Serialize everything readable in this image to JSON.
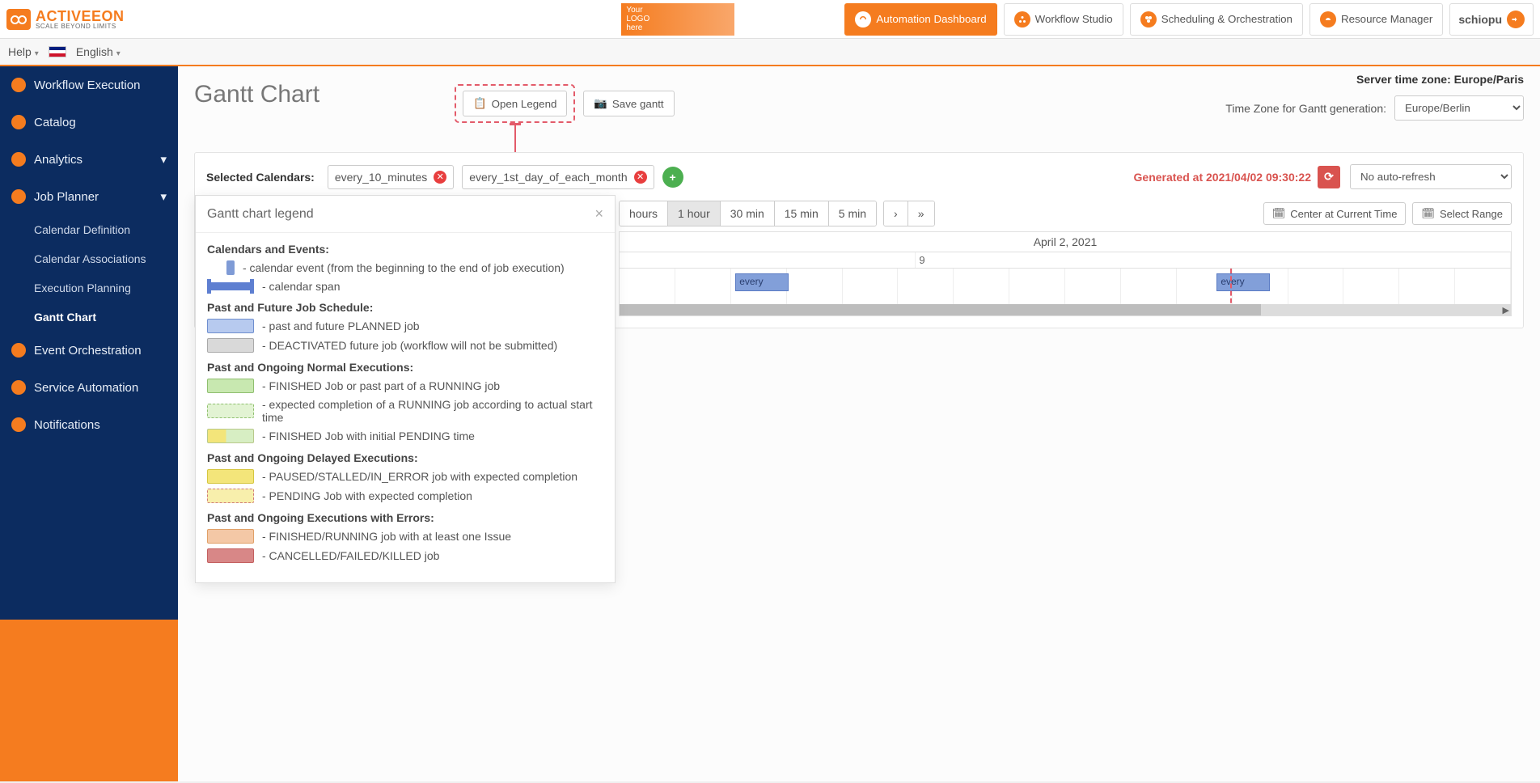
{
  "header": {
    "brand": "ACTIVEEON",
    "tagline": "SCALE BEYOND LIMITS",
    "your_logo_lines": [
      "Your",
      "LOGO",
      "here"
    ],
    "nav": {
      "dashboard": "Automation Dashboard",
      "studio": "Workflow Studio",
      "scheduling": "Scheduling & Orchestration",
      "resource": "Resource Manager"
    },
    "user": "schiopu"
  },
  "secondbar": {
    "help": "Help",
    "language": "English"
  },
  "sidebar": {
    "items": [
      {
        "label": "Workflow Execution"
      },
      {
        "label": "Catalog"
      },
      {
        "label": "Analytics",
        "expandable": true
      },
      {
        "label": "Job Planner",
        "expandable": true
      }
    ],
    "jobplanner_children": [
      {
        "label": "Calendar Definition"
      },
      {
        "label": "Calendar Associations"
      },
      {
        "label": "Execution Planning"
      },
      {
        "label": "Gantt Chart",
        "active": true
      }
    ],
    "items_after": [
      {
        "label": "Event Orchestration"
      },
      {
        "label": "Service Automation"
      },
      {
        "label": "Notifications"
      }
    ]
  },
  "main": {
    "server_tz_label": "Server time zone: Europe/Paris",
    "title": "Gantt Chart",
    "open_legend": "Open Legend",
    "save_gantt": "Save gantt",
    "tz_label": "Time Zone for Gantt generation:",
    "tz_value": "Europe/Berlin",
    "selected_calendars_label": "Selected Calendars:",
    "calendars": [
      "every_10_minutes",
      "every_1st_day_of_each_month"
    ],
    "generated_label": "Generated at 2021/04/02 09:30:22",
    "autorefresh": "No auto-refresh",
    "zoom_levels": [
      "hours",
      "1 hour",
      "30 min",
      "15 min",
      "5 min"
    ],
    "zoom_selected_index": 1,
    "center_btn": "Center at Current Time",
    "range_btn": "Select Range",
    "gantt_date": "April 2, 2021",
    "gantt_hours": [
      "9"
    ],
    "gantt_bars": [
      {
        "label": "every",
        "left_pct": 13,
        "width_pct": 6
      },
      {
        "label": "every",
        "left_pct": 67,
        "width_pct": 6
      }
    ],
    "now_marker_pct": 68.5
  },
  "legend": {
    "title": "Gantt chart legend",
    "sections": {
      "cal_events": "Calendars and Events:",
      "cal_event_desc": "- calendar event (from the beginning to the end of job execution)",
      "cal_span_desc": "- calendar span",
      "past_future": "Past and Future Job Schedule:",
      "planned": "- past and future PLANNED job",
      "deactivated": "- DEACTIVATED future job (workflow will not be submitted)",
      "normal_exec": "Past and Ongoing Normal Executions:",
      "finished": "- FINISHED Job or past part of a RUNNING job",
      "expected": "- expected completion of a RUNNING job according to actual start time",
      "finished_pending": "- FINISHED Job with initial PENDING time",
      "delayed": "Past and Ongoing Delayed Executions:",
      "paused": "- PAUSED/STALLED/IN_ERROR job with expected completion",
      "pending": "- PENDING Job with expected completion",
      "errors": "Past and Ongoing Executions with Errors:",
      "with_issue": "- FINISHED/RUNNING job with at least one Issue",
      "cancelled": "- CANCELLED/FAILED/KILLED job"
    }
  }
}
